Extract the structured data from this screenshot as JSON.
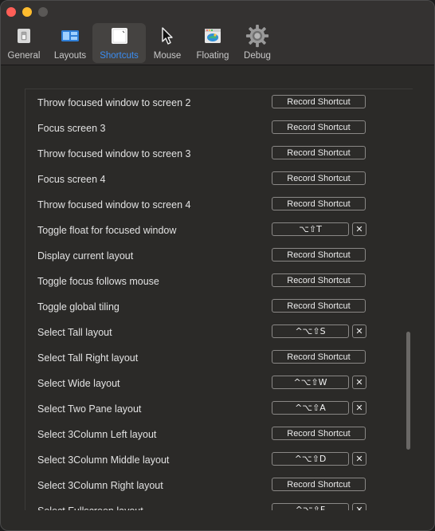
{
  "toolbar": {
    "items": [
      {
        "label": "General",
        "icon": "general-switch-icon"
      },
      {
        "label": "Layouts",
        "icon": "layouts-icon"
      },
      {
        "label": "Shortcuts",
        "icon": "shortcuts-icon"
      },
      {
        "label": "Mouse",
        "icon": "mouse-cursor-icon"
      },
      {
        "label": "Floating",
        "icon": "floating-icon"
      },
      {
        "label": "Debug",
        "icon": "gear-icon"
      }
    ],
    "selected": "Shortcuts"
  },
  "colors": {
    "accent": "#3b8ef3",
    "close": "#ff5f57",
    "minimize": "#febc2e",
    "background": "#2b2a28"
  },
  "shortcuts": {
    "record_label": "Record Shortcut",
    "clear_glyph": "✕",
    "rows": [
      {
        "name": "Throw focused window to screen 2",
        "keys": ""
      },
      {
        "name": "Focus screen 3",
        "keys": ""
      },
      {
        "name": "Throw focused window to screen 3",
        "keys": ""
      },
      {
        "name": "Focus screen 4",
        "keys": ""
      },
      {
        "name": "Throw focused window to screen 4",
        "keys": ""
      },
      {
        "name": "Toggle float for focused window",
        "keys": "⌥⇧T"
      },
      {
        "name": "Display current layout",
        "keys": ""
      },
      {
        "name": "Toggle focus follows mouse",
        "keys": ""
      },
      {
        "name": "Toggle global tiling",
        "keys": ""
      },
      {
        "name": "Select Tall layout",
        "keys": "^⌥⇧S"
      },
      {
        "name": "Select Tall Right layout",
        "keys": ""
      },
      {
        "name": "Select Wide layout",
        "keys": "^⌥⇧W"
      },
      {
        "name": "Select Two Pane layout",
        "keys": "^⌥⇧A"
      },
      {
        "name": "Select 3Column Left layout",
        "keys": ""
      },
      {
        "name": "Select 3Column Middle layout",
        "keys": "^⌥⇧D"
      },
      {
        "name": "Select 3Column Right layout",
        "keys": ""
      },
      {
        "name": "Select Fullscreen layout",
        "keys": "^⌥⇧F"
      }
    ]
  }
}
